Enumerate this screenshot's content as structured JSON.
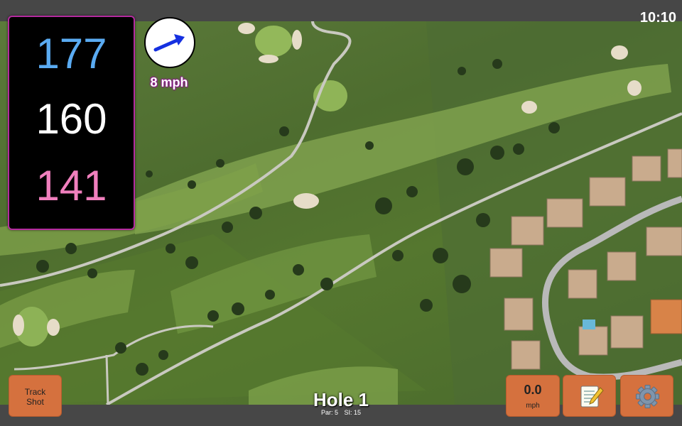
{
  "status": {
    "time": "10:10"
  },
  "yardage": {
    "back": "177",
    "middle": "160",
    "front": "141"
  },
  "wind": {
    "speed": "8 mph",
    "icon": "wind-direction-arrow-icon"
  },
  "buttons": {
    "track_shot": [
      "Track",
      "Shot"
    ],
    "speed_value": "0.0",
    "speed_unit": "mph",
    "notes_icon": "notepad-icon",
    "settings_icon": "gear-icon"
  },
  "hole": {
    "title": "Hole 1",
    "par": "Par: 5",
    "si": "SI: 15"
  },
  "colors": {
    "back_yardage": "#5aabf2",
    "middle_yardage": "#ffffff",
    "front_yardage": "#f07fbd",
    "button": "#d5713e",
    "panel_border": "#b52ba0"
  }
}
